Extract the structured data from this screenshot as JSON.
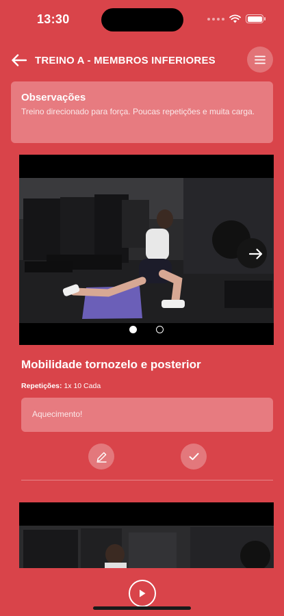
{
  "status_bar": {
    "time": "13:30"
  },
  "header": {
    "title": "TREINO A - MEMBROS INFERIORES",
    "back_icon": "arrow-left-icon",
    "menu_icon": "menu-icon"
  },
  "observations": {
    "title": "Observações",
    "text": "Treino direcionado para força. Poucas repetições e muita carga."
  },
  "exercise": {
    "title": "Mobilidade tornozelo e posterior",
    "reps_label": "Repetições:",
    "reps_value": "1x 10 Cada",
    "note": "Aquecimento!",
    "carousel": {
      "active_index": 0,
      "count": 2
    }
  },
  "colors": {
    "background": "#d9444a",
    "card": "#e77b80",
    "text": "#ffffff"
  },
  "icons": {
    "edit": "pencil-icon",
    "complete": "check-icon",
    "play": "play-icon",
    "next": "arrow-right-icon"
  }
}
